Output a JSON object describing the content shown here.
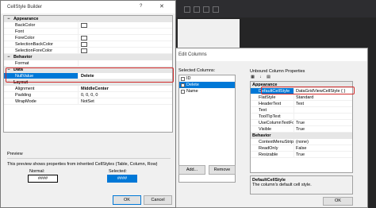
{
  "cellstyle_builder": {
    "title": "CellStyle Builder",
    "help_label": "?",
    "close_label": "✕",
    "categories": [
      {
        "name": "Appearance",
        "rows": [
          {
            "name": "BackColor",
            "value": "",
            "swatch": true
          },
          {
            "name": "Font",
            "value": "",
            "ellipsis": true
          },
          {
            "name": "ForeColor",
            "value": "",
            "swatch": true
          },
          {
            "name": "SelectionBackColor",
            "value": "",
            "swatch": true
          },
          {
            "name": "SelectionForeColor",
            "value": "",
            "swatch": true
          }
        ]
      },
      {
        "name": "Behavior",
        "rows": [
          {
            "name": "Format",
            "value": ""
          }
        ]
      },
      {
        "name": "Data",
        "rows": [
          {
            "name": "NullValue",
            "value": "Delete",
            "selected": true
          }
        ]
      },
      {
        "name": "Layout",
        "rows": [
          {
            "name": "Alignment",
            "value": "MiddleCenter"
          },
          {
            "name": "Padding",
            "value": "0, 0, 0, 0"
          },
          {
            "name": "WrapMode",
            "value": "NotSet"
          }
        ]
      }
    ],
    "preview": {
      "label": "Preview",
      "description": "This preview shows properties from inherited CellStyles (Table, Column, Row)",
      "normal_label": "Normal:",
      "selected_label": "Selected:",
      "normal_text": "####",
      "selected_text": "####"
    },
    "buttons": {
      "ok": "OK",
      "cancel": "Cancel"
    }
  },
  "edit_columns": {
    "title": "Edit Columns",
    "selected_columns_label": "Selected Columns:",
    "columns": [
      {
        "name": "ID",
        "selected": false
      },
      {
        "name": "Delete",
        "selected": true
      },
      {
        "name": "Name",
        "selected": false
      }
    ],
    "add_label": "Add...",
    "remove_label": "Remove",
    "properties_label": "Unbound Column Properties",
    "categories": [
      {
        "name": "Appearance",
        "rows": [
          {
            "name": "DefaultCellStyle",
            "value": "DataGridViewCellStyle { }",
            "highlighted": true
          },
          {
            "name": "FlatStyle",
            "value": "Standard"
          },
          {
            "name": "HeaderText",
            "value": "Text"
          },
          {
            "name": "Text",
            "value": ""
          },
          {
            "name": "ToolTipText",
            "value": ""
          },
          {
            "name": "UseColumnTextForBu",
            "value": "True"
          },
          {
            "name": "Visible",
            "value": "True"
          }
        ]
      },
      {
        "name": "Behavior",
        "rows": [
          {
            "name": "ContextMenuStrip",
            "value": "(none)"
          },
          {
            "name": "ReadOnly",
            "value": "False"
          },
          {
            "name": "Resizable",
            "value": "True"
          }
        ]
      }
    ],
    "description": {
      "title": "DefaultCellStyle",
      "text": "The column's default cell style."
    },
    "ok_label": "OK"
  },
  "colors": {
    "selection": "#0078d7",
    "highlight_box": "#d12b2b",
    "ide_background": "#1e1e1e"
  }
}
